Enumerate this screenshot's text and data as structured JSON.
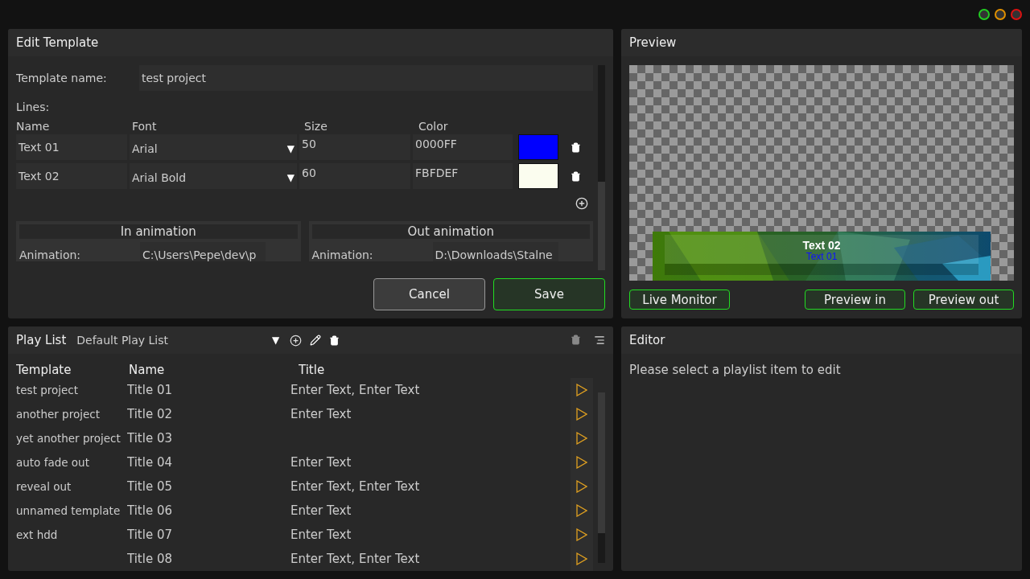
{
  "window_controls": [
    {
      "color": "#22cc22"
    },
    {
      "color": "#e09000"
    },
    {
      "color": "#dd1111"
    }
  ],
  "edit_template": {
    "title": "Edit Template",
    "name_label": "Template name:",
    "name_value": "test project",
    "lines_label": "Lines:",
    "columns": [
      "Name",
      "Font",
      "Size",
      "Color"
    ],
    "lines": [
      {
        "name": "Text 01",
        "font": "Arial",
        "size": "50",
        "color_hex": "0000FF",
        "color": "#0000ff"
      },
      {
        "name": "Text 02",
        "font": "Arial Bold",
        "size": "60",
        "color_hex": "FBFDEF",
        "color": "#fbfdef"
      }
    ],
    "dropdown_glyph": "▼",
    "animations": [
      {
        "title": "In animation",
        "label": "Animation:",
        "path": "C:\\Users\\Pepe\\dev\\p"
      },
      {
        "title": "Out animation",
        "label": "Animation:",
        "path": "D:\\Downloads\\Stalne"
      }
    ],
    "buttons": [
      {
        "label": "Cancel",
        "kind": "plain"
      },
      {
        "label": "Save",
        "kind": "primary"
      }
    ]
  },
  "preview": {
    "title": "Preview",
    "overlay_lines": [
      {
        "text": "Text 02",
        "kind": "main"
      },
      {
        "text": "Text 01",
        "kind": "sub"
      }
    ],
    "buttons": [
      "Live Monitor",
      "Preview in",
      "Preview out"
    ]
  },
  "playlist": {
    "title": "Play List",
    "selected_list": "Default Play List",
    "dropdown_glyph": "▼",
    "columns": [
      "Template",
      "Name",
      "Title"
    ],
    "rows": [
      {
        "template": "test project",
        "name": "Title 01",
        "title": "Enter Text, Enter Text"
      },
      {
        "template": "another project",
        "name": "Title 02",
        "title": "Enter Text"
      },
      {
        "template": "yet another project",
        "name": "Title 03"
      },
      {
        "template": "auto fade out",
        "name": "Title 04",
        "title": "Enter Text"
      },
      {
        "template": "reveal out",
        "name": "Title 05",
        "title": "Enter Text, Enter Text"
      },
      {
        "template": "unnamed template",
        "name": "Title 06",
        "title": "Enter Text"
      },
      {
        "template": "ext hdd",
        "name": "Title 07",
        "title": "Enter Text"
      },
      {
        "name": "Title 08",
        "title": "Enter Text, Enter Text"
      }
    ]
  },
  "editor": {
    "title": "Editor",
    "message": "Please select a playlist item to edit"
  }
}
